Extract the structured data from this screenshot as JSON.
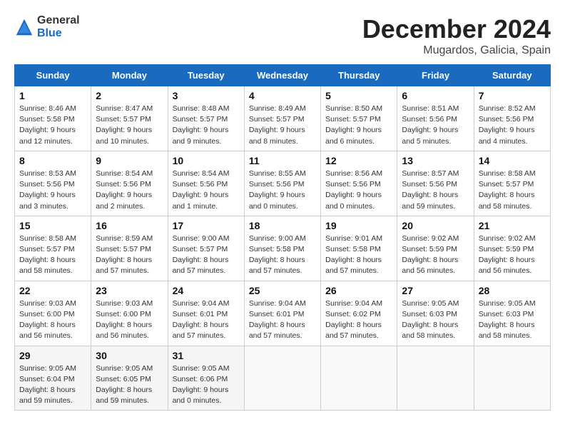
{
  "logo": {
    "general": "General",
    "blue": "Blue"
  },
  "header": {
    "month": "December 2024",
    "location": "Mugardos, Galicia, Spain"
  },
  "weekdays": [
    "Sunday",
    "Monday",
    "Tuesday",
    "Wednesday",
    "Thursday",
    "Friday",
    "Saturday"
  ],
  "weeks": [
    [
      {
        "day": "1",
        "info": "Sunrise: 8:46 AM\nSunset: 5:58 PM\nDaylight: 9 hours and 12 minutes."
      },
      {
        "day": "2",
        "info": "Sunrise: 8:47 AM\nSunset: 5:57 PM\nDaylight: 9 hours and 10 minutes."
      },
      {
        "day": "3",
        "info": "Sunrise: 8:48 AM\nSunset: 5:57 PM\nDaylight: 9 hours and 9 minutes."
      },
      {
        "day": "4",
        "info": "Sunrise: 8:49 AM\nSunset: 5:57 PM\nDaylight: 9 hours and 8 minutes."
      },
      {
        "day": "5",
        "info": "Sunrise: 8:50 AM\nSunset: 5:57 PM\nDaylight: 9 hours and 6 minutes."
      },
      {
        "day": "6",
        "info": "Sunrise: 8:51 AM\nSunset: 5:56 PM\nDaylight: 9 hours and 5 minutes."
      },
      {
        "day": "7",
        "info": "Sunrise: 8:52 AM\nSunset: 5:56 PM\nDaylight: 9 hours and 4 minutes."
      }
    ],
    [
      {
        "day": "8",
        "info": "Sunrise: 8:53 AM\nSunset: 5:56 PM\nDaylight: 9 hours and 3 minutes."
      },
      {
        "day": "9",
        "info": "Sunrise: 8:54 AM\nSunset: 5:56 PM\nDaylight: 9 hours and 2 minutes."
      },
      {
        "day": "10",
        "info": "Sunrise: 8:54 AM\nSunset: 5:56 PM\nDaylight: 9 hours and 1 minute."
      },
      {
        "day": "11",
        "info": "Sunrise: 8:55 AM\nSunset: 5:56 PM\nDaylight: 9 hours and 0 minutes."
      },
      {
        "day": "12",
        "info": "Sunrise: 8:56 AM\nSunset: 5:56 PM\nDaylight: 9 hours and 0 minutes."
      },
      {
        "day": "13",
        "info": "Sunrise: 8:57 AM\nSunset: 5:56 PM\nDaylight: 8 hours and 59 minutes."
      },
      {
        "day": "14",
        "info": "Sunrise: 8:58 AM\nSunset: 5:57 PM\nDaylight: 8 hours and 58 minutes."
      }
    ],
    [
      {
        "day": "15",
        "info": "Sunrise: 8:58 AM\nSunset: 5:57 PM\nDaylight: 8 hours and 58 minutes."
      },
      {
        "day": "16",
        "info": "Sunrise: 8:59 AM\nSunset: 5:57 PM\nDaylight: 8 hours and 57 minutes."
      },
      {
        "day": "17",
        "info": "Sunrise: 9:00 AM\nSunset: 5:57 PM\nDaylight: 8 hours and 57 minutes."
      },
      {
        "day": "18",
        "info": "Sunrise: 9:00 AM\nSunset: 5:58 PM\nDaylight: 8 hours and 57 minutes."
      },
      {
        "day": "19",
        "info": "Sunrise: 9:01 AM\nSunset: 5:58 PM\nDaylight: 8 hours and 57 minutes."
      },
      {
        "day": "20",
        "info": "Sunrise: 9:02 AM\nSunset: 5:59 PM\nDaylight: 8 hours and 56 minutes."
      },
      {
        "day": "21",
        "info": "Sunrise: 9:02 AM\nSunset: 5:59 PM\nDaylight: 8 hours and 56 minutes."
      }
    ],
    [
      {
        "day": "22",
        "info": "Sunrise: 9:03 AM\nSunset: 6:00 PM\nDaylight: 8 hours and 56 minutes."
      },
      {
        "day": "23",
        "info": "Sunrise: 9:03 AM\nSunset: 6:00 PM\nDaylight: 8 hours and 56 minutes."
      },
      {
        "day": "24",
        "info": "Sunrise: 9:04 AM\nSunset: 6:01 PM\nDaylight: 8 hours and 57 minutes."
      },
      {
        "day": "25",
        "info": "Sunrise: 9:04 AM\nSunset: 6:01 PM\nDaylight: 8 hours and 57 minutes."
      },
      {
        "day": "26",
        "info": "Sunrise: 9:04 AM\nSunset: 6:02 PM\nDaylight: 8 hours and 57 minutes."
      },
      {
        "day": "27",
        "info": "Sunrise: 9:05 AM\nSunset: 6:03 PM\nDaylight: 8 hours and 58 minutes."
      },
      {
        "day": "28",
        "info": "Sunrise: 9:05 AM\nSunset: 6:03 PM\nDaylight: 8 hours and 58 minutes."
      }
    ],
    [
      {
        "day": "29",
        "info": "Sunrise: 9:05 AM\nSunset: 6:04 PM\nDaylight: 8 hours and 59 minutes."
      },
      {
        "day": "30",
        "info": "Sunrise: 9:05 AM\nSunset: 6:05 PM\nDaylight: 8 hours and 59 minutes."
      },
      {
        "day": "31",
        "info": "Sunrise: 9:05 AM\nSunset: 6:06 PM\nDaylight: 9 hours and 0 minutes."
      },
      {
        "day": "",
        "info": ""
      },
      {
        "day": "",
        "info": ""
      },
      {
        "day": "",
        "info": ""
      },
      {
        "day": "",
        "info": ""
      }
    ]
  ]
}
